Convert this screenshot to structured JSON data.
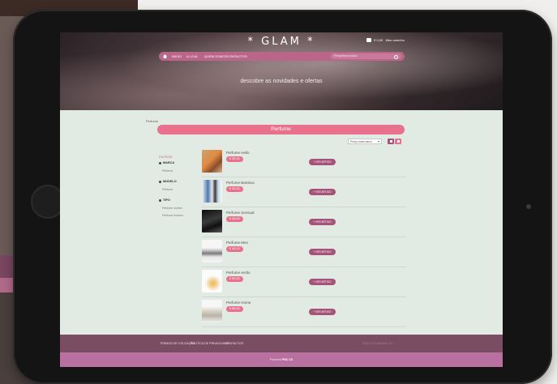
{
  "site": {
    "logo": "* GLAM *",
    "cart_total": "€ 0,00",
    "cart_link": "Meu carrinho",
    "tagline": "descobre as novidades e ofertas"
  },
  "nav": {
    "items": [
      "INICIO",
      "A LOJA",
      "QUEM SOMOS",
      "CONTACTOS"
    ],
    "search_placeholder": "Pesquisar produto"
  },
  "breadcrumb": "Perfume",
  "page_title": "Perfume",
  "sort": {
    "selected": "Preço mais baixo"
  },
  "filters": {
    "title": "FILTROS",
    "groups": [
      {
        "label": "MARCA",
        "options": [
          "Perfume"
        ]
      },
      {
        "label": "MODELO",
        "options": [
          "Perfume"
        ]
      },
      {
        "label": "TIPO",
        "options": [
          "Perfume mulher",
          "Perfume homem"
        ]
      }
    ]
  },
  "products": [
    {
      "name": "Perfume Hello",
      "price": "€ 25,00",
      "button": "VER ARTIGO"
    },
    {
      "name": "Perfume Bamboo",
      "price": "€ 32,00",
      "button": "VER ARTIGO"
    },
    {
      "name": "Perfume Sensual",
      "price": "€ 40,00",
      "button": "VER ARTIGO"
    },
    {
      "name": "Perfume Men",
      "price": "€ 45,00",
      "button": "VER ARTIGO"
    },
    {
      "name": "Perfume verão",
      "price": "€ 50,00",
      "button": "VER ARTIGO"
    },
    {
      "name": "Perfume Home",
      "price": "€ 65,00",
      "button": "VER ARTIGO"
    }
  ],
  "footer": {
    "links": [
      "TERMOS DE UTILIZAÇÃO",
      "POLÍTICA DE PRIVACIDADE",
      "CONTACTOS"
    ],
    "copyright": "2015 © GLAMOUR CO.",
    "powered_prefix": "Powered",
    "powered_brand": "PNC CS"
  },
  "colors": {
    "accent_pink": "#e8728e",
    "nav_mauve": "#b9668a",
    "button_mauve": "#a55379",
    "footer": "#7a4d63",
    "background": "#e1eae3"
  }
}
